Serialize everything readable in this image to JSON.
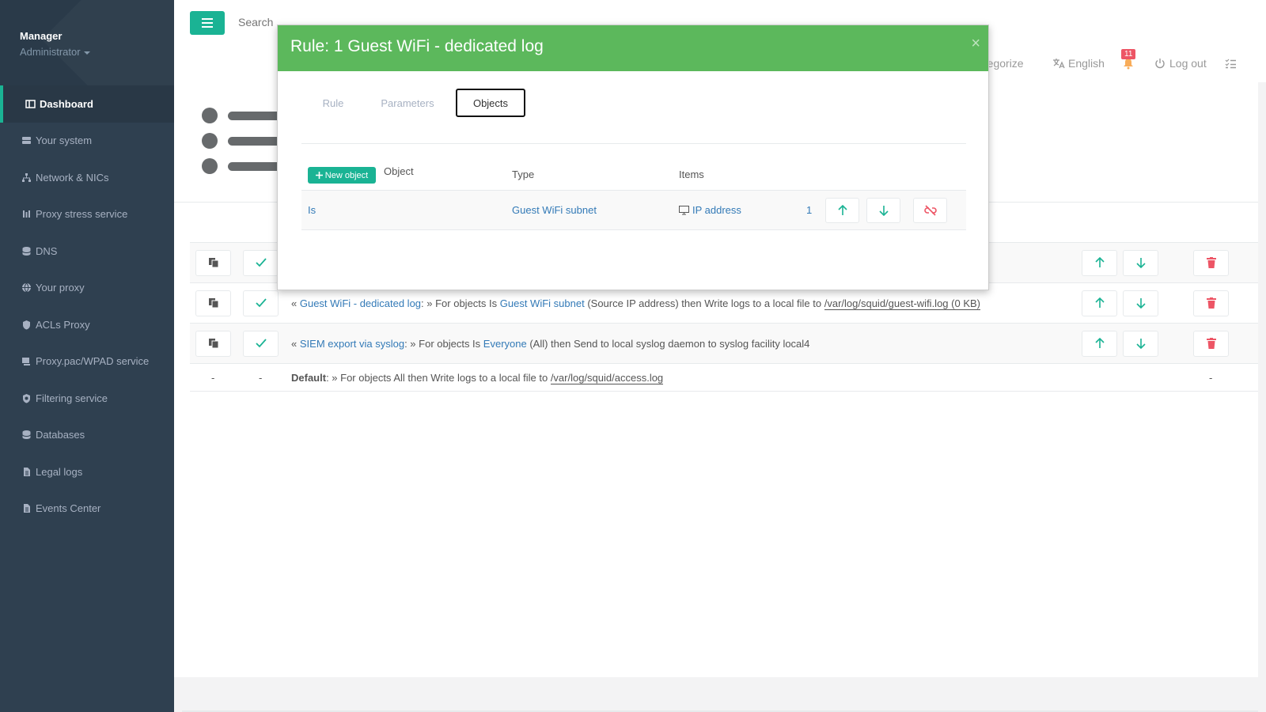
{
  "profile": {
    "name": "Manager",
    "role": "Administrator"
  },
  "sidebar": {
    "items": [
      {
        "label": "Dashboard",
        "icon": "dashboard-icon"
      },
      {
        "label": "Your system",
        "icon": "server-icon"
      },
      {
        "label": "Network & NICs",
        "icon": "network-icon"
      },
      {
        "label": "Proxy stress service",
        "icon": "stress-icon"
      },
      {
        "label": "DNS",
        "icon": "database-icon"
      },
      {
        "label": "Your proxy",
        "icon": "globe-icon"
      },
      {
        "label": "ACLs Proxy",
        "icon": "shield-icon"
      },
      {
        "label": "Proxy.pac/WPAD service",
        "icon": "computer-icon"
      },
      {
        "label": "Filtering service",
        "icon": "shield-check-icon"
      },
      {
        "label": "Databases",
        "icon": "database-icon"
      },
      {
        "label": "Legal logs",
        "icon": "file-icon"
      },
      {
        "label": "Events Center",
        "icon": "file-icon"
      }
    ]
  },
  "topbar": {
    "search_placeholder": "Search",
    "categorize": "ategorize",
    "language": "English",
    "notification_count": "11",
    "logout": "Log out"
  },
  "rules": [
    {
      "open": "«",
      "name": "Guest WiFi - dedicated log",
      "mid1": ": » For objects Is",
      "object": "Guest WiFi subnet",
      "mid2": "(Source IP address) then Write logs to a local file to",
      "path": "/var/log/squid/guest-wifi.log (0 KB)"
    },
    {
      "open": "«",
      "name": "SIEM export via syslog",
      "mid1": ": » For objects Is",
      "object": "Everyone",
      "mid2": "(All) then Send to local syslog daemon to syslog facility local4"
    }
  ],
  "default_rule": {
    "dash": "-",
    "label": "Default",
    "text": ": » For objects All then Write logs to a local file to",
    "path": "/var/log/squid/access.log"
  },
  "modal": {
    "title": "Rule: 1 Guest WiFi - dedicated log",
    "close": "×",
    "tabs": [
      "Rule",
      "Parameters",
      "Objects"
    ],
    "active_tab": "Objects",
    "new_object": "New object",
    "columns": {
      "object": "Object",
      "type": "Type",
      "items": "Items"
    },
    "row": {
      "operator": "Is",
      "type": "Guest WiFi subnet",
      "items": "IP address",
      "count": "1"
    }
  },
  "colors": {
    "sidebar": "#2f4050",
    "accent": "#1ab394",
    "modal_header": "#5cb85c",
    "link": "#337ab7",
    "danger": "#ed5565"
  }
}
